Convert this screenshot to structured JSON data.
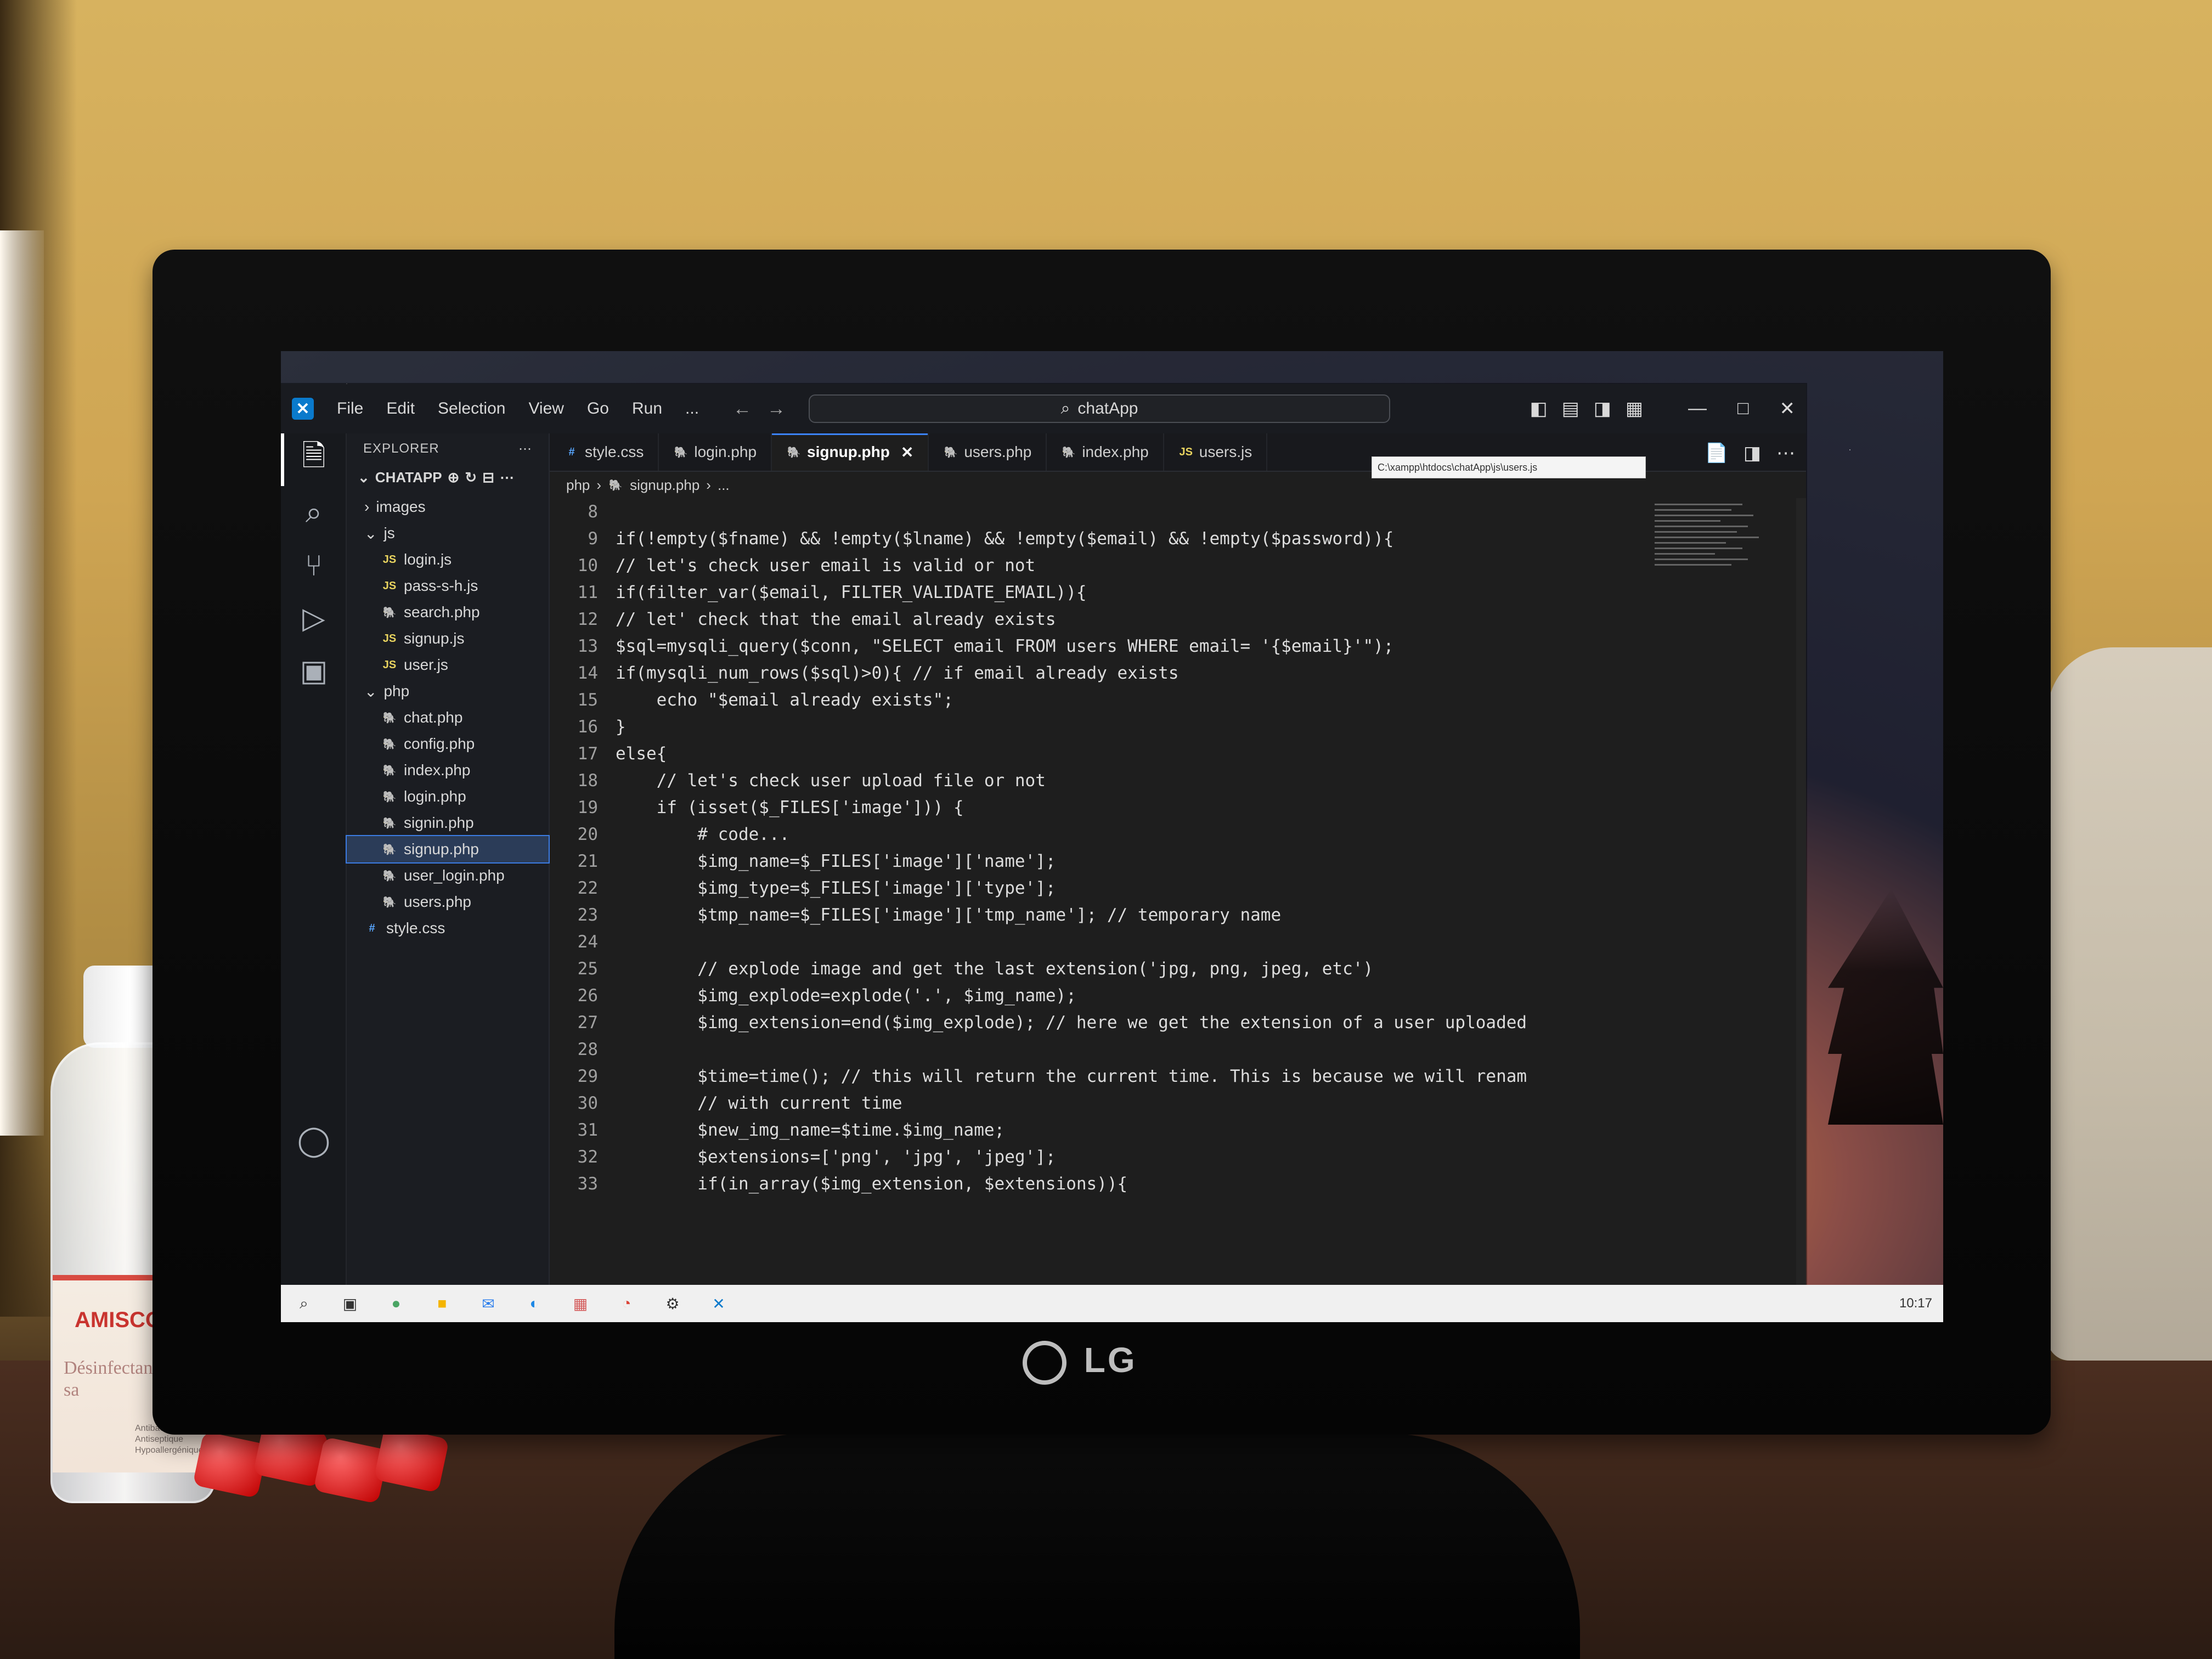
{
  "window": {
    "title": "chatApp"
  },
  "menu": [
    "File",
    "Edit",
    "Selection",
    "View",
    "Go",
    "Run",
    "..."
  ],
  "explorer": {
    "header": "EXPLORER",
    "project": "CHATAPP",
    "tree": [
      {
        "label": "images",
        "type": "folder",
        "level": 1
      },
      {
        "label": "js",
        "type": "folder",
        "level": 1
      },
      {
        "label": "login.js",
        "type": "js",
        "level": 2
      },
      {
        "label": "pass-s-h.js",
        "type": "js",
        "level": 2
      },
      {
        "label": "search.php",
        "type": "php",
        "level": 2
      },
      {
        "label": "signup.js",
        "type": "js",
        "level": 2
      },
      {
        "label": "user.js",
        "type": "js",
        "level": 2
      },
      {
        "label": "php",
        "type": "folder",
        "level": 1
      },
      {
        "label": "chat.php",
        "type": "php",
        "level": 2
      },
      {
        "label": "config.php",
        "type": "php",
        "level": 2
      },
      {
        "label": "index.php",
        "type": "php",
        "level": 2
      },
      {
        "label": "login.php",
        "type": "php",
        "level": 2
      },
      {
        "label": "signin.php",
        "type": "php",
        "level": 2
      },
      {
        "label": "signup.php",
        "type": "php",
        "level": 2,
        "active": true
      },
      {
        "label": "user_login.php",
        "type": "php",
        "level": 2
      },
      {
        "label": "users.php",
        "type": "php",
        "level": 2
      },
      {
        "label": "style.css",
        "type": "css",
        "level": 1
      }
    ]
  },
  "tabs": [
    {
      "label": "style.css",
      "type": "css"
    },
    {
      "label": "login.php",
      "type": "php"
    },
    {
      "label": "signup.php",
      "type": "php",
      "active": true
    },
    {
      "label": "users.php",
      "type": "php"
    },
    {
      "label": "index.php",
      "type": "php"
    },
    {
      "label": "users.js",
      "type": "js"
    }
  ],
  "tab_tooltip": "C:\\xampp\\htdocs\\chatApp\\js\\users.js",
  "breadcrumb": [
    "php",
    "signup.php",
    "..."
  ],
  "code_lines": [
    {
      "ln": "8",
      "text": ""
    },
    {
      "ln": "9",
      "text": "if(!empty($fname) && !empty($lname) && !empty($email) && !empty($password)){"
    },
    {
      "ln": "10",
      "text": "// let's check user email is valid or not"
    },
    {
      "ln": "11",
      "text": "if(filter_var($email, FILTER_VALIDATE_EMAIL)){"
    },
    {
      "ln": "12",
      "text": "// let' check that the email already exists"
    },
    {
      "ln": "13",
      "text": "$sql=mysqli_query($conn, \"SELECT email FROM users WHERE email= '{$email}'\");"
    },
    {
      "ln": "14",
      "text": "if(mysqli_num_rows($sql)>0){ // if email already exists"
    },
    {
      "ln": "15",
      "text": "    echo \"$email already exists\";"
    },
    {
      "ln": "16",
      "text": "}"
    },
    {
      "ln": "17",
      "text": "else{"
    },
    {
      "ln": "18",
      "text": "    // let's check user upload file or not"
    },
    {
      "ln": "19",
      "text": "    if (isset($_FILES['image'])) {"
    },
    {
      "ln": "20",
      "text": "        # code..."
    },
    {
      "ln": "21",
      "text": "        $img_name=$_FILES['image']['name'];"
    },
    {
      "ln": "22",
      "text": "        $img_type=$_FILES['image']['type'];"
    },
    {
      "ln": "23",
      "text": "        $tmp_name=$_FILES['image']['tmp_name']; // temporary name"
    },
    {
      "ln": "24",
      "text": ""
    },
    {
      "ln": "25",
      "text": "        // explode image and get the last extension('jpg, png, jpeg, etc')"
    },
    {
      "ln": "26",
      "text": "        $img_explode=explode('.', $img_name);"
    },
    {
      "ln": "27",
      "text": "        $img_extension=end($img_explode); // here we get the extension of a user uploaded"
    },
    {
      "ln": "28",
      "text": ""
    },
    {
      "ln": "29",
      "text": "        $time=time(); // this will return the current time. This is because we will renam"
    },
    {
      "ln": "30",
      "text": "        // with current time"
    },
    {
      "ln": "31",
      "text": "        $new_img_name=$time.$img_name;"
    },
    {
      "ln": "32",
      "text": "        $extensions=['png', 'jpg', 'jpeg'];"
    },
    {
      "ln": "33",
      "text": "        if(in_array($img_extension, $extensions)){"
    }
  ],
  "taskbar": {
    "time": "10:17"
  },
  "bottle": {
    "brand": "AMISCO",
    "label": "Désinfectant Hand sa",
    "small": [
      "Antibactérienne",
      "Antiseptique",
      "Hypoallergénique"
    ]
  },
  "monitor_brand": "LG",
  "colors": {
    "accent": "#3b82f6",
    "selection": "#2b3c58",
    "editor_bg": "#1e1e1e",
    "sidebar_bg": "#1b1d22"
  },
  "icons": {
    "explorer": "files-icon",
    "search": "search-icon",
    "source_control": "source-control-icon",
    "run": "run-debug-icon",
    "extensions": "extensions-icon",
    "account": "account-icon"
  }
}
